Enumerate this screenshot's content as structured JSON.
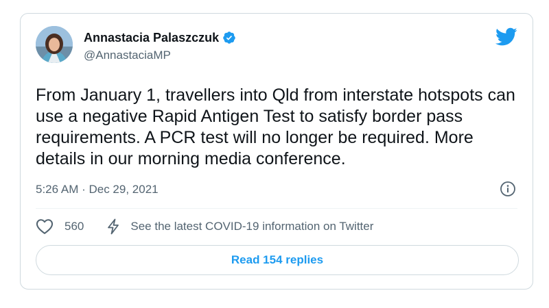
{
  "author": {
    "display_name": "Annastacia Palaszczuk",
    "handle": "@AnnastaciaMP",
    "verified": true
  },
  "tweet": {
    "text": "From January 1, travellers into Qld from interstate hotspots can use a negative Rapid Antigen Test to satisfy border pass requirements. A PCR test will no longer be required. More details in our morning media conference.",
    "timestamp": "5:26 AM · Dec 29, 2021"
  },
  "actions": {
    "like_count": "560",
    "covid_link": "See the latest COVID-19 information on Twitter"
  },
  "replies_button": {
    "label": "Read 154 replies"
  },
  "icons": {
    "brand": "twitter-bird-icon",
    "verified": "verified-badge-icon",
    "info": "info-icon",
    "like": "heart-icon",
    "covid": "lightning-bolt-icon"
  },
  "colors": {
    "brand_blue": "#1d9bf0",
    "text": "#0f1419",
    "secondary_text": "#536471",
    "border": "#cfd9de"
  }
}
